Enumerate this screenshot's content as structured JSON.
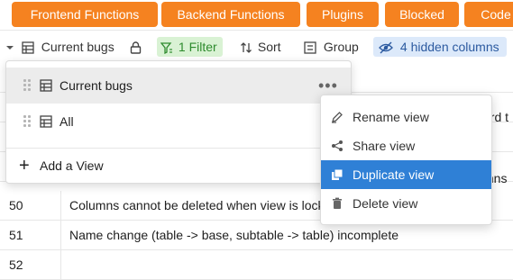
{
  "tabs": [
    "Frontend Functions",
    "Backend Functions",
    "Plugins",
    "Blocked",
    "Code"
  ],
  "toolbar": {
    "view_name": "Current bugs",
    "filter_label": "1 Filter",
    "sort_label": "Sort",
    "group_label": "Group",
    "hidden_label": "4 hidden columns"
  },
  "views_dropdown": {
    "items": [
      {
        "label": "Current bugs",
        "more": "•••"
      },
      {
        "label": "All"
      }
    ],
    "add_label": "Add a View"
  },
  "context_menu": {
    "items": [
      {
        "label": "Rename view",
        "icon": "pencil-icon"
      },
      {
        "label": "Share view",
        "icon": "share-icon"
      },
      {
        "label": "Duplicate view",
        "icon": "duplicate-icon"
      },
      {
        "label": "Delete view",
        "icon": "trash-icon"
      }
    ]
  },
  "background": {
    "fragment_1": "ard t",
    "fragment_2": "mns"
  },
  "rows": [
    {
      "num": "50",
      "text": "Columns cannot be deleted when view is lock"
    },
    {
      "num": "51",
      "text": "Name change (table -> base, subtable -> table) incomplete"
    },
    {
      "num": "52",
      "text": ""
    }
  ],
  "colors": {
    "tab_bg": "#f58220",
    "filter_bg": "#d9f2d4",
    "hidden_bg": "#dce9fa",
    "highlight": "#2f80d6"
  }
}
